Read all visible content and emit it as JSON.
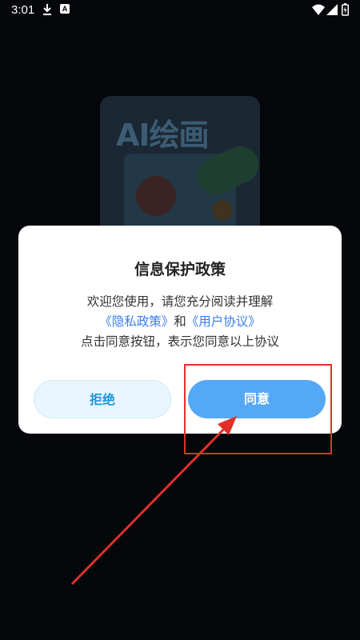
{
  "status_bar": {
    "time": "3:01",
    "icons": [
      "download-icon",
      "a-app-icon",
      "wifi-icon",
      "signal-icon",
      "battery-icon"
    ],
    "a_glyph": "A"
  },
  "background": {
    "card_title": "AI绘画"
  },
  "dialog": {
    "title": "信息保护政策",
    "line1": "欢迎您使用，请您充分阅读并理解",
    "privacy_link": "《隐私政策》",
    "and_text": "和",
    "agreement_link": "《用户协议》",
    "line3": "点击同意按钮，表示您同意以上协议",
    "reject_label": "拒绝",
    "agree_label": "同意"
  },
  "colors": {
    "link": "#3a7ef0",
    "agree_button": "#55a8f5",
    "reject_text": "#1d96d9",
    "annotation": "#e0302a"
  }
}
